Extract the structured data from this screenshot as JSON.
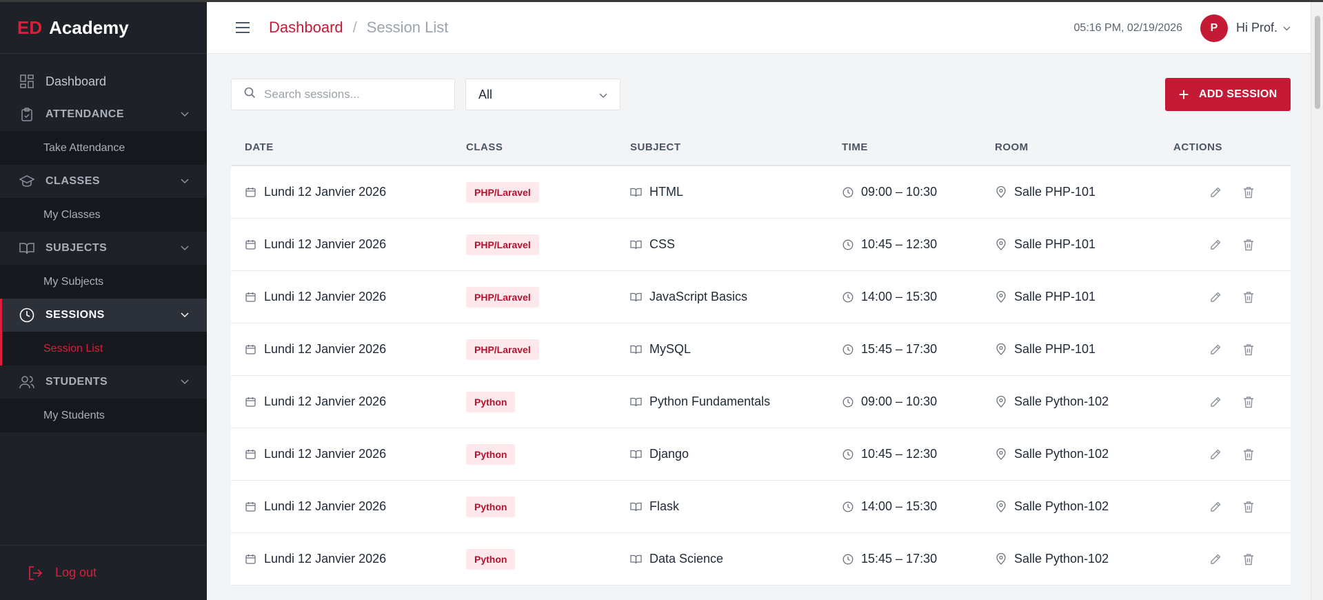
{
  "brand": {
    "prefix": "ED",
    "name": "Academy"
  },
  "sidebar": {
    "dashboard_label": "Dashboard",
    "sections": [
      {
        "label": "ATTENDANCE",
        "icon": "clipboard-check-icon",
        "sub": "Take Attendance"
      },
      {
        "label": "CLASSES",
        "icon": "graduation-cap-icon",
        "sub": "My Classes"
      },
      {
        "label": "SUBJECTS",
        "icon": "book-open-icon",
        "sub": "My Subjects"
      },
      {
        "label": "SESSIONS",
        "icon": "clock-icon",
        "sub": "Session List",
        "active": true
      },
      {
        "label": "STUDENTS",
        "icon": "users-icon",
        "sub": "My Students"
      }
    ],
    "logout_label": "Log out"
  },
  "header": {
    "breadcrumb_root": "Dashboard",
    "breadcrumb_sep": "/",
    "breadcrumb_current": "Session List",
    "datetime": "05:16 PM, 02/19/2026",
    "avatar_initial": "P",
    "greeting": "Hi Prof."
  },
  "toolbar": {
    "search_placeholder": "Search sessions...",
    "filter_value": "All",
    "add_label": "ADD SESSION"
  },
  "table": {
    "columns": [
      "DATE",
      "CLASS",
      "SUBJECT",
      "TIME",
      "ROOM",
      "ACTIONS"
    ],
    "rows": [
      {
        "date": "Lundi 12 Janvier 2026",
        "class": "PHP/Laravel",
        "subject": "HTML",
        "time": "09:00 – 10:30",
        "room": "Salle PHP-101"
      },
      {
        "date": "Lundi 12 Janvier 2026",
        "class": "PHP/Laravel",
        "subject": "CSS",
        "time": "10:45 – 12:30",
        "room": "Salle PHP-101"
      },
      {
        "date": "Lundi 12 Janvier 2026",
        "class": "PHP/Laravel",
        "subject": "JavaScript Basics",
        "time": "14:00 – 15:30",
        "room": "Salle PHP-101"
      },
      {
        "date": "Lundi 12 Janvier 2026",
        "class": "PHP/Laravel",
        "subject": "MySQL",
        "time": "15:45 – 17:30",
        "room": "Salle PHP-101"
      },
      {
        "date": "Lundi 12 Janvier 2026",
        "class": "Python",
        "subject": "Python Fundamentals",
        "time": "09:00 – 10:30",
        "room": "Salle Python-102"
      },
      {
        "date": "Lundi 12 Janvier 2026",
        "class": "Python",
        "subject": "Django",
        "time": "10:45 – 12:30",
        "room": "Salle Python-102"
      },
      {
        "date": "Lundi 12 Janvier 2026",
        "class": "Python",
        "subject": "Flask",
        "time": "14:00 – 15:30",
        "room": "Salle Python-102"
      },
      {
        "date": "Lundi 12 Janvier 2026",
        "class": "Python",
        "subject": "Data Science",
        "time": "15:45 – 17:30",
        "room": "Salle Python-102"
      }
    ]
  },
  "colors": {
    "accent": "#c41a35",
    "sidebar_bg": "#1e2128",
    "badge_bg": "#fde8eb"
  }
}
